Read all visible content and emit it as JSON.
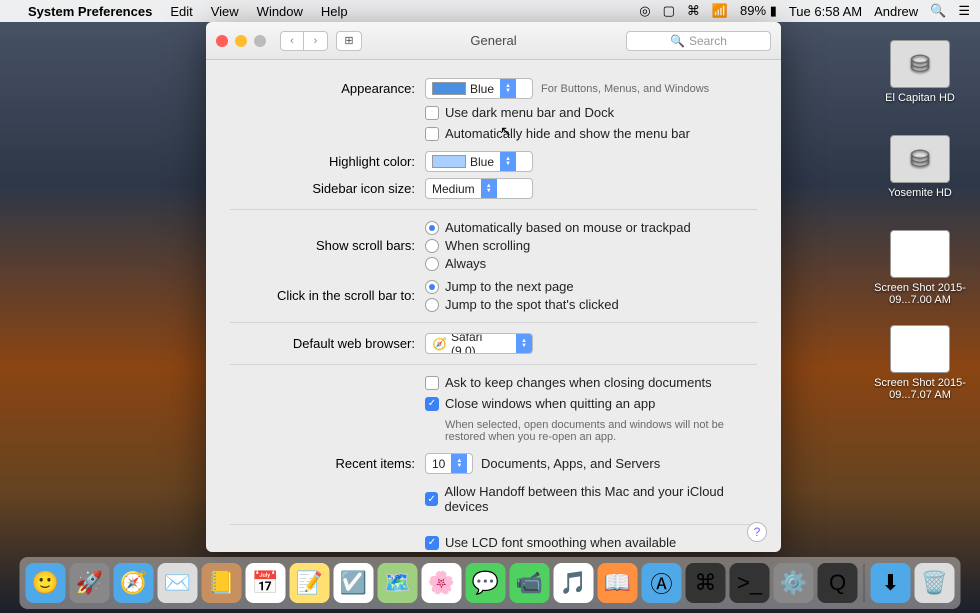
{
  "menubar": {
    "app": "System Preferences",
    "items": [
      "Edit",
      "View",
      "Window",
      "Help"
    ],
    "battery": "89%",
    "clock": "Tue 6:58 AM",
    "user": "Andrew"
  },
  "desktop": {
    "icons": [
      {
        "label": "El Capitan HD",
        "glyph": "⛁"
      },
      {
        "label": "Yosemite HD",
        "glyph": "⛁"
      },
      {
        "label": "Screen Shot 2015-09...7.00 AM",
        "glyph": ""
      },
      {
        "label": "Screen Shot 2015-09...7.07 AM",
        "glyph": ""
      }
    ]
  },
  "window": {
    "title": "General",
    "search_placeholder": "Search",
    "appearance": {
      "label": "Appearance:",
      "value": "Blue",
      "hint": "For Buttons, Menus, and Windows",
      "dark_menubar": "Use dark menu bar and Dock",
      "autohide": "Automatically hide and show the menu bar"
    },
    "highlight": {
      "label": "Highlight color:",
      "value": "Blue"
    },
    "sidebar": {
      "label": "Sidebar icon size:",
      "value": "Medium"
    },
    "scrollbars": {
      "label": "Show scroll bars:",
      "options": [
        "Automatically based on mouse or trackpad",
        "When scrolling",
        "Always"
      ],
      "selected": 0
    },
    "clickbar": {
      "label": "Click in the scroll bar to:",
      "options": [
        "Jump to the next page",
        "Jump to the spot that's clicked"
      ],
      "selected": 0
    },
    "browser": {
      "label": "Default web browser:",
      "value": "Safari (9.0)"
    },
    "askchanges": "Ask to keep changes when closing documents",
    "closewin": {
      "label": "Close windows when quitting an app",
      "hint": "When selected, open documents and windows will not be restored when you re-open an app."
    },
    "recent": {
      "label": "Recent items:",
      "value": "10",
      "hint": "Documents, Apps, and Servers"
    },
    "handoff": "Allow Handoff between this Mac and your iCloud devices",
    "lcd": "Use LCD font smoothing when available"
  },
  "dock": {
    "items": [
      {
        "name": "finder",
        "glyph": "🙂",
        "bg": "#4fa8e8"
      },
      {
        "name": "launchpad",
        "glyph": "🚀",
        "bg": "#888"
      },
      {
        "name": "safari",
        "glyph": "🧭",
        "bg": "#4fa8e8"
      },
      {
        "name": "mail",
        "glyph": "✉️",
        "bg": "#ddd"
      },
      {
        "name": "contacts",
        "glyph": "📒",
        "bg": "#c89060"
      },
      {
        "name": "calendar",
        "glyph": "📅",
        "bg": "#fff"
      },
      {
        "name": "notes",
        "glyph": "📝",
        "bg": "#ffe070"
      },
      {
        "name": "reminders",
        "glyph": "☑️",
        "bg": "#fff"
      },
      {
        "name": "maps",
        "glyph": "🗺️",
        "bg": "#9fd080"
      },
      {
        "name": "photos",
        "glyph": "🌸",
        "bg": "#fff"
      },
      {
        "name": "messages",
        "glyph": "💬",
        "bg": "#50d060"
      },
      {
        "name": "facetime",
        "glyph": "📹",
        "bg": "#50d060"
      },
      {
        "name": "itunes",
        "glyph": "🎵",
        "bg": "#fff"
      },
      {
        "name": "ibooks",
        "glyph": "📖",
        "bg": "#ff9040"
      },
      {
        "name": "appstore",
        "glyph": "Ⓐ",
        "bg": "#4fa8e8"
      },
      {
        "name": "terminal",
        "glyph": "⌘",
        "bg": "#333"
      },
      {
        "name": "terminal2",
        "glyph": ">_",
        "bg": "#333"
      },
      {
        "name": "preferences",
        "glyph": "⚙️",
        "bg": "#888"
      },
      {
        "name": "quicktime",
        "glyph": "Q",
        "bg": "#333"
      }
    ],
    "right": [
      {
        "name": "downloads",
        "glyph": "⬇",
        "bg": "#4fa8e8"
      },
      {
        "name": "trash",
        "glyph": "🗑️",
        "bg": "#ddd"
      }
    ]
  }
}
